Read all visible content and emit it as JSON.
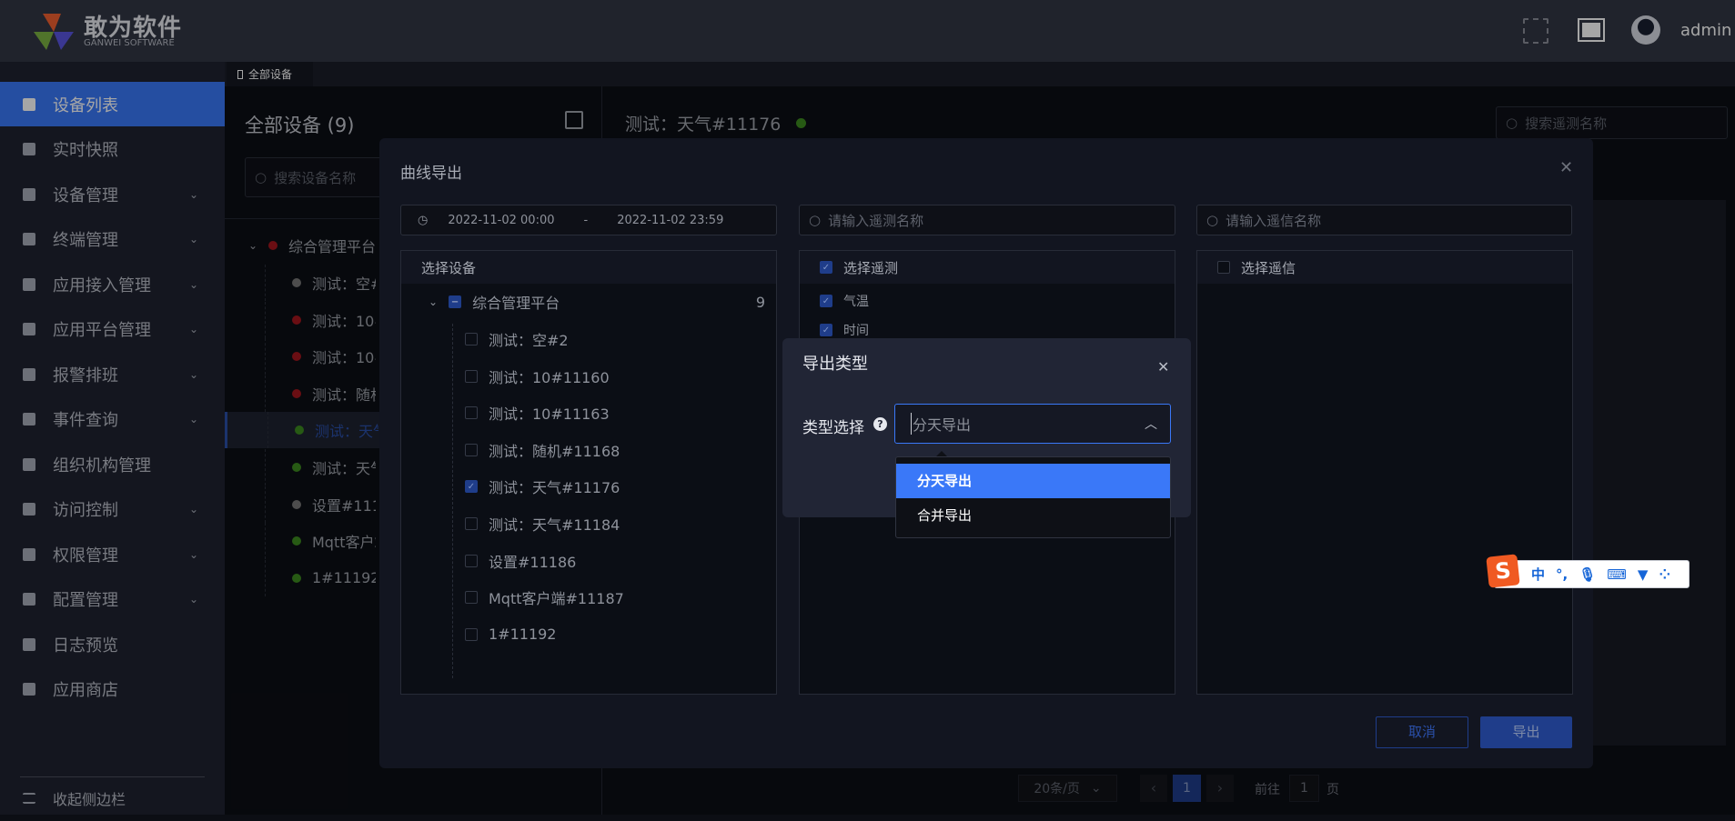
{
  "header": {
    "brand_cn": "敢为软件",
    "brand_en": "GANWEI SOFTWARE",
    "user": "admin"
  },
  "sidebar": {
    "items": [
      {
        "label": "设备列表",
        "chevron": false,
        "active": true
      },
      {
        "label": "实时快照",
        "chevron": false
      },
      {
        "label": "设备管理",
        "chevron": true
      },
      {
        "label": "终端管理",
        "chevron": true
      },
      {
        "label": "应用接入管理",
        "chevron": true
      },
      {
        "label": "应用平台管理",
        "chevron": true
      },
      {
        "label": "报警排班",
        "chevron": true
      },
      {
        "label": "事件查询",
        "chevron": true
      },
      {
        "label": "组织机构管理",
        "chevron": false
      },
      {
        "label": "访问控制",
        "chevron": true
      },
      {
        "label": "权限管理",
        "chevron": true
      },
      {
        "label": "配置管理",
        "chevron": true
      },
      {
        "label": "日志预览",
        "chevron": false
      },
      {
        "label": "应用商店",
        "chevron": false
      }
    ],
    "collapse": "收起侧边栏"
  },
  "tab": {
    "label": "全部设备"
  },
  "devices": {
    "title": "全部设备 (9)",
    "search_placeholder": "搜索设备名称",
    "root": "综合管理平台",
    "items": [
      {
        "label": "测试：空#2",
        "status": "grey"
      },
      {
        "label": "测试：10#11160",
        "status": "red"
      },
      {
        "label": "测试：10#11163",
        "status": "red"
      },
      {
        "label": "测试：随机#11168",
        "status": "red"
      },
      {
        "label": "测试：天气#11176",
        "status": "green",
        "selected": true
      },
      {
        "label": "测试：天气#11184",
        "status": "green"
      },
      {
        "label": "设置#11186",
        "status": "grey"
      },
      {
        "label": "Mqtt客户端#11187",
        "status": "green"
      },
      {
        "label": "1#11192",
        "status": "green"
      }
    ]
  },
  "detail": {
    "title": "测试：天气#11176",
    "search_placeholder": "搜索遥测名称"
  },
  "pagination": {
    "page_size": "20条/页",
    "current": "1",
    "goto_label": "前往",
    "goto_value": "1",
    "page_suffix": "页"
  },
  "export_modal": {
    "title": "曲线导出",
    "date_start": "2022-11-02 00:00",
    "date_sep": "-",
    "date_end": "2022-11-02 23:59",
    "telemetry_placeholder": "请输入遥测名称",
    "signal_placeholder": "请输入遥信名称",
    "device_header": "选择设备",
    "root": "综合管理平台",
    "root_count": "9",
    "devices": [
      {
        "label": "测试：空#2",
        "checked": false
      },
      {
        "label": "测试：10#11160",
        "checked": false
      },
      {
        "label": "测试：10#11163",
        "checked": false
      },
      {
        "label": "测试：随机#11168",
        "checked": false
      },
      {
        "label": "测试：天气#11176",
        "checked": true
      },
      {
        "label": "测试：天气#11184",
        "checked": false
      },
      {
        "label": "设置#11186",
        "checked": false
      },
      {
        "label": "Mqtt客户端#11187",
        "checked": false
      },
      {
        "label": "1#11192",
        "checked": false
      }
    ],
    "telemetry_header": "选择遥测",
    "telemetry": [
      {
        "label": "气温",
        "checked": true
      },
      {
        "label": "时间",
        "checked": true
      }
    ],
    "signal_header": "选择遥信",
    "cancel": "取消",
    "export": "导出"
  },
  "type_dialog": {
    "title": "导出类型",
    "label": "类型选择",
    "value": "分天导出",
    "options": [
      "分天导出",
      "合并导出"
    ],
    "selected_index": 0
  },
  "ime": {
    "mode": "中",
    "punct": "°,"
  },
  "colors": {
    "accent": "#3a78f8",
    "sidebar": "#1f2330",
    "header": "#323644"
  }
}
